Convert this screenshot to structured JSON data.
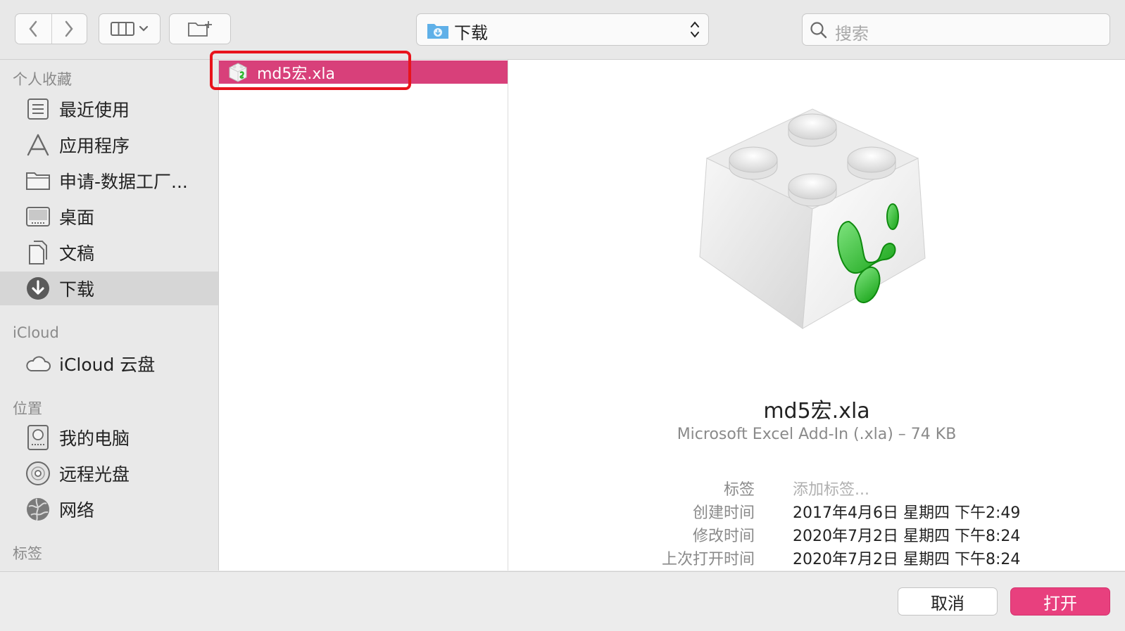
{
  "toolbar": {
    "path_label": "下载",
    "search_placeholder": "搜索"
  },
  "sidebar": {
    "sections": {
      "favorites": "个人收藏",
      "icloud": "iCloud",
      "locations": "位置",
      "tags": "标签"
    },
    "favorites": [
      {
        "label": "最近使用",
        "icon": "recents-icon"
      },
      {
        "label": "应用程序",
        "icon": "applications-icon"
      },
      {
        "label": "申请-数据工厂...",
        "icon": "folder-icon"
      },
      {
        "label": "桌面",
        "icon": "desktop-icon"
      },
      {
        "label": "文稿",
        "icon": "documents-icon"
      },
      {
        "label": "下载",
        "icon": "downloads-icon",
        "selected": true
      }
    ],
    "icloud": [
      {
        "label": "iCloud 云盘",
        "icon": "cloud-icon"
      }
    ],
    "locations": [
      {
        "label": "我的电脑",
        "icon": "hard-drive-icon"
      },
      {
        "label": "远程光盘",
        "icon": "disc-icon"
      },
      {
        "label": "网络",
        "icon": "network-icon"
      }
    ]
  },
  "file_list": {
    "selected_file": "md5宏.xla"
  },
  "preview": {
    "name": "md5宏.xla",
    "kind_size": "Microsoft Excel Add-In (.xla) – 74 KB",
    "meta": [
      {
        "key": "标签",
        "value": "添加标签...",
        "placeholder": true
      },
      {
        "key": "创建时间",
        "value": "2017年4月6日 星期四 下午2:49"
      },
      {
        "key": "修改时间",
        "value": "2020年7月2日 星期四 下午8:24"
      },
      {
        "key": "上次打开时间",
        "value": "2020年7月2日 星期四 下午8:24"
      }
    ]
  },
  "buttons": {
    "cancel": "取消",
    "open": "打开"
  },
  "colors": {
    "accent": "#e8407e",
    "selection": "#d8407a",
    "highlight_box": "#e8141c"
  }
}
